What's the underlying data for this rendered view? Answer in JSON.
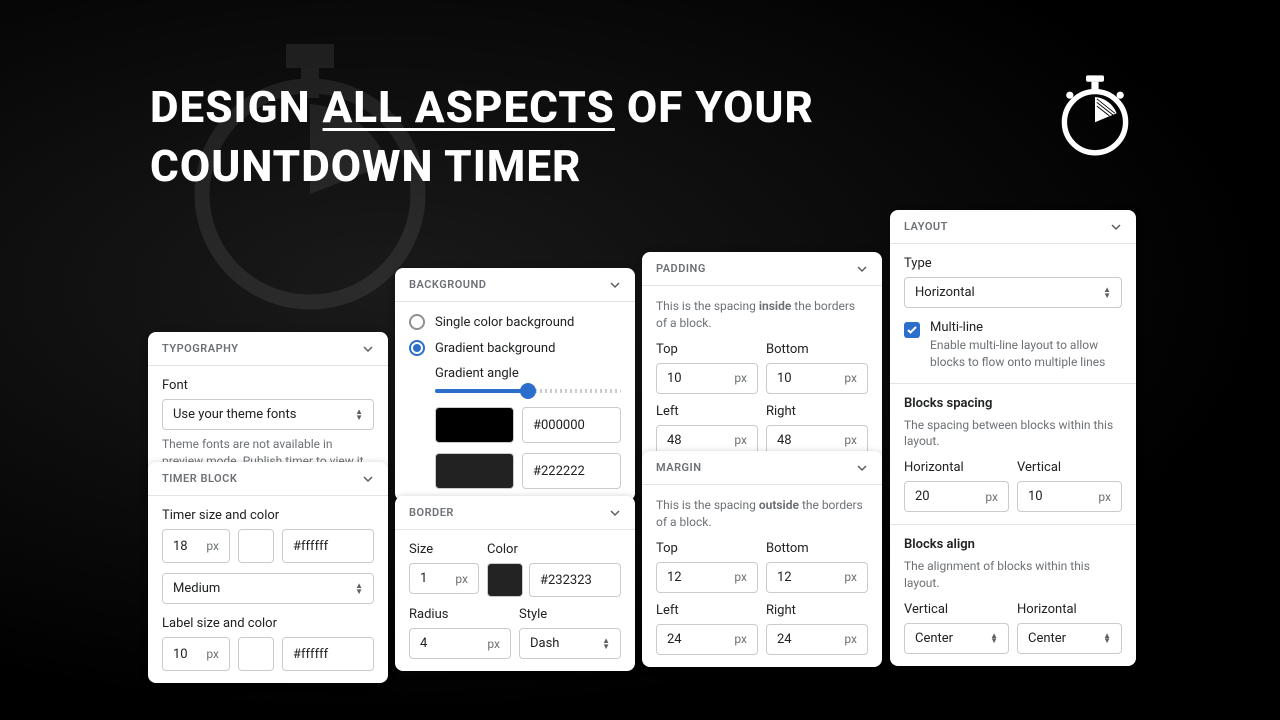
{
  "headline_pre": "DESIGN ",
  "headline_u": "ALL ASPECTS",
  "headline_post": " OF YOUR",
  "headline_line2": "COUNTDOWN TIMER",
  "typography": {
    "title": "TYPOGRAPHY",
    "font_label": "Font",
    "font_value": "Use your theme fonts",
    "hint": "Theme fonts are not available in preview mode. Publish timer to view it in store."
  },
  "timerblock": {
    "title": "TIMER BLOCK",
    "size_label": "Timer size and color",
    "size_value": "18",
    "size_unit": "px",
    "color_value": "#ffffff",
    "weight_value": "Medium",
    "label_label": "Label size and color",
    "label_size": "10",
    "label_unit": "px",
    "label_color": "#ffffff"
  },
  "background": {
    "title": "BACKGROUND",
    "opt_single": "Single color background",
    "opt_gradient": "Gradient background",
    "angle_label": "Gradient angle",
    "color1": "#000000",
    "color2": "#222222"
  },
  "border": {
    "title": "BORDER",
    "size_label": "Size",
    "size_value": "1",
    "size_unit": "px",
    "color_label": "Color",
    "color_value": "#232323",
    "radius_label": "Radius",
    "radius_value": "4",
    "radius_unit": "px",
    "style_label": "Style",
    "style_value": "Dash"
  },
  "padding": {
    "title": "PADDING",
    "hint_pre": "This is the spacing ",
    "hint_bold": "inside",
    "hint_post": " the borders of a block.",
    "top_label": "Top",
    "top_value": "10",
    "bottom_label": "Bottom",
    "bottom_value": "10",
    "left_label": "Left",
    "left_value": "48",
    "right_label": "Right",
    "right_value": "48",
    "unit": "px"
  },
  "margin": {
    "title": "MARGIN",
    "hint_pre": "This is the spacing ",
    "hint_bold": "outside",
    "hint_post": " the borders of a block.",
    "top_label": "Top",
    "top_value": "12",
    "bottom_label": "Bottom",
    "bottom_value": "12",
    "left_label": "Left",
    "left_value": "24",
    "right_label": "Right",
    "right_value": "24",
    "unit": "px"
  },
  "layout": {
    "title": "LAYOUT",
    "type_label": "Type",
    "type_value": "Horizontal",
    "multiline_label": "Multi-line",
    "multiline_hint": "Enable multi-line layout to allow blocks to flow onto multiple lines",
    "spacing_title": "Blocks spacing",
    "spacing_hint": "The spacing between blocks within this layout.",
    "h_label": "Horizontal",
    "h_value": "20",
    "v_label": "Vertical",
    "v_value": "10",
    "unit": "px",
    "align_title": "Blocks align",
    "align_hint": "The alignment of blocks within this layout.",
    "av_label": "Vertical",
    "av_value": "Center",
    "ah_label": "Horizontal",
    "ah_value": "Center"
  }
}
